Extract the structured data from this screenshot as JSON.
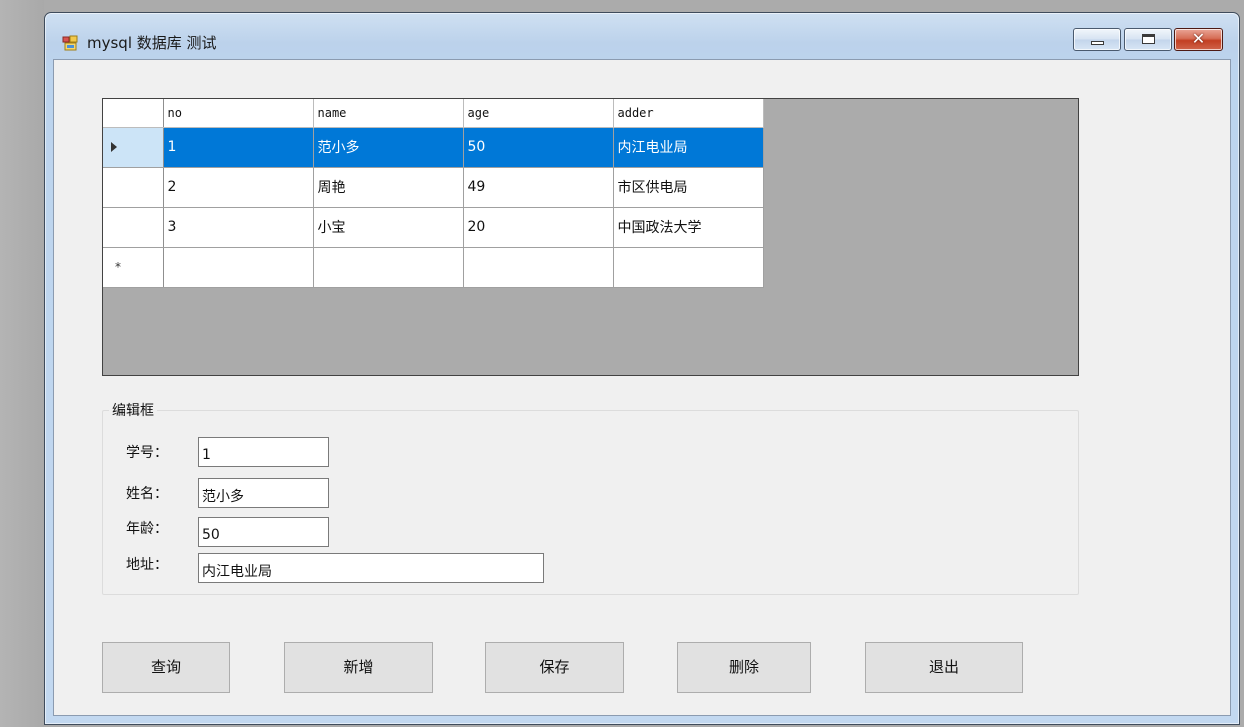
{
  "window": {
    "title": "mysql 数据库 测试",
    "close_symbol": "✕"
  },
  "grid": {
    "columns": [
      "no",
      "name",
      "age",
      "adder"
    ],
    "rows": [
      [
        "1",
        "范小多",
        "50",
        "内江电业局"
      ],
      [
        "2",
        "周艳",
        "49",
        "市区供电局"
      ],
      [
        "3",
        "小宝",
        "20",
        "中国政法大学"
      ]
    ],
    "selected_row_index": 0,
    "new_row_marker": "*"
  },
  "editor": {
    "group_title": "编辑框",
    "fields": [
      {
        "label": "学号：",
        "value": "1"
      },
      {
        "label": "姓名：",
        "value": "范小多"
      },
      {
        "label": "年龄：",
        "value": "50"
      },
      {
        "label": "地址：",
        "value": "内江电业局"
      }
    ]
  },
  "buttons": {
    "query": "查询",
    "add": "新增",
    "save": "保存",
    "delete": "删除",
    "exit": "退出"
  },
  "colors": {
    "selection": "#0078d7",
    "row_header_selected": "#cce4f7",
    "grid_background": "#ababab",
    "close_button": "#c23e22"
  },
  "icons": [
    "app-icon",
    "minimize-icon",
    "maximize-icon",
    "close-icon",
    "current-row-arrow-icon",
    "new-row-star-icon"
  ]
}
